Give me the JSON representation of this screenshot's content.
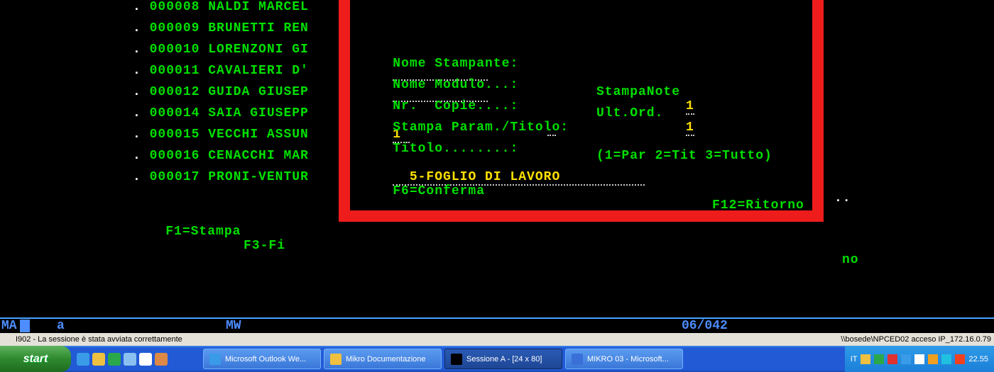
{
  "list": [
    {
      "prefix": ". ",
      "id": "000008",
      "name": "NALDI MARCEL"
    },
    {
      "prefix": ". ",
      "id": "000009",
      "name": "BRUNETTI REN"
    },
    {
      "prefix": ". ",
      "id": "000010",
      "name": "LORENZONI GI"
    },
    {
      "prefix": ". ",
      "id": "000011",
      "name": "CAVALIERI D'"
    },
    {
      "prefix": ". ",
      "id": "000012",
      "name": "GUIDA GIUSEP"
    },
    {
      "prefix": ". ",
      "id": "000014",
      "name": "SAIA GIUSEPP"
    },
    {
      "prefix": ". ",
      "id": "000015",
      "name": "VECCHI ASSUN"
    },
    {
      "prefix": ". ",
      "id": "000016",
      "name": "CENACCHI MAR"
    },
    {
      "prefix": ". ",
      "id": "000017",
      "name": "PRONI-VENTUR"
    }
  ],
  "panel": {
    "nomeStampanteLbl": "Nome Stampante:",
    "stampaNoteLbl": "StampaNote",
    "stampaNoteVal": "1",
    "nomeModuloLbl": "Nome Modulo...:",
    "ultOrdLbl": "Ult.Ord.",
    "ultOrdVal": "1",
    "nrCopieLbl": "Nr.  Copie....:",
    "nrCopieVal": "1",
    "stampaParamLbl": "Stampa Param./Titolo:",
    "stampaParamHint": "(1=Par 2=Tit 3=Tutto)",
    "titoloLbl": "Titolo........:",
    "titoloVal": "5-FOGLIO DI LAVORO",
    "f6": "F6=Conferma",
    "f12": "F12=Ritorno"
  },
  "footer": {
    "f1": "F1=Stampa",
    "f3": "F3-Fi",
    "no": "no",
    "dots": ".."
  },
  "statusA": {
    "ma": "MA",
    "a": "a",
    "mw": "MW",
    "pos": "06/042"
  },
  "statusB": {
    "left": "I902 - La sessione è stata avviata correttamente",
    "right": "\\\\bosede\\NPCED02 acceso IP_172.16.0.79"
  },
  "taskbar": {
    "start": "start",
    "tasks": [
      {
        "label": "Microsoft Outlook We...",
        "color": "#3a9be8"
      },
      {
        "label": "Mikro Documentazione",
        "color": "#f0c040"
      },
      {
        "label": "Sessione A - [24 x 80]",
        "color": "#000",
        "active": true
      },
      {
        "label": "MIKRO 03 - Microsoft...",
        "color": "#3a6fd8"
      }
    ],
    "lang": "IT",
    "clock": "22.55"
  }
}
